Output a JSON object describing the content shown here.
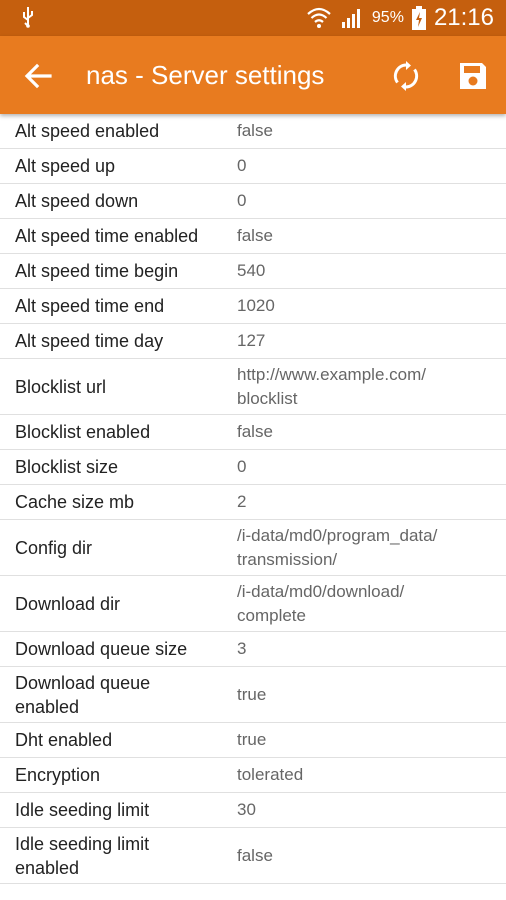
{
  "status_bar": {
    "battery": "95%",
    "time": "21:16",
    "icons": [
      "usb-icon",
      "wifi-icon",
      "signal-icon",
      "battery-charging-icon"
    ]
  },
  "app_bar": {
    "title": "nas - Server settings",
    "icons": [
      "back-arrow-icon",
      "sync-icon",
      "save-icon"
    ],
    "color": "#e87b1f"
  },
  "settings": [
    {
      "key": "Alt speed enabled",
      "value": "false"
    },
    {
      "key": "Alt speed up",
      "value": "0"
    },
    {
      "key": "Alt speed down",
      "value": "0"
    },
    {
      "key": "Alt speed time enabled",
      "value": "false"
    },
    {
      "key": "Alt speed time begin",
      "value": "540"
    },
    {
      "key": "Alt speed time end",
      "value": "1020"
    },
    {
      "key": "Alt speed time day",
      "value": "127"
    },
    {
      "key": "Blocklist url",
      "value": "http://www.example.com/\nblocklist"
    },
    {
      "key": "Blocklist enabled",
      "value": "false"
    },
    {
      "key": "Blocklist size",
      "value": "0"
    },
    {
      "key": "Cache size mb",
      "value": "2"
    },
    {
      "key": "Config dir",
      "value": "/i-data/md0/program_data/\ntransmission/"
    },
    {
      "key": "Download dir",
      "value": "/i-data/md0/download/\ncomplete"
    },
    {
      "key": "Download queue size",
      "value": "3"
    },
    {
      "key": "Download queue\nenabled",
      "value": "true"
    },
    {
      "key": "Dht enabled",
      "value": "true"
    },
    {
      "key": "Encryption",
      "value": "tolerated"
    },
    {
      "key": "Idle seeding limit",
      "value": "30"
    },
    {
      "key": "Idle seeding limit\nenabled",
      "value": "false"
    }
  ]
}
